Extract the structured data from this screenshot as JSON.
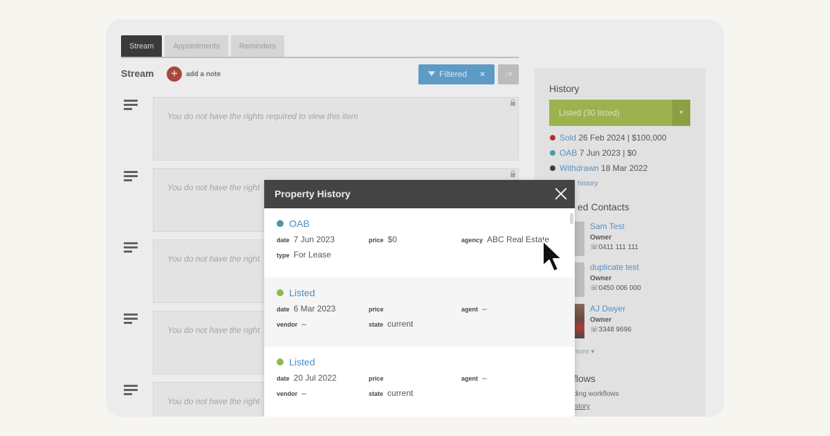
{
  "tabs": [
    "Stream",
    "Appointments",
    "Reminders"
  ],
  "stream": {
    "title": "Stream",
    "add_note": "add a note",
    "filter_label": "Filtered",
    "filter_clear": "×",
    "sort_label": "↓≡",
    "items": [
      "You do not have the rights required to view this item",
      "You do not have the right",
      "You do not have the right",
      "You do not have the right",
      "You do not have the right"
    ]
  },
  "side": {
    "history_title": "History",
    "listed_select": "Listed (30 listed)",
    "history": [
      {
        "status": "Sold",
        "detail": "26 Feb 2024 | $100,000",
        "color": "#b4302a"
      },
      {
        "status": "OAB",
        "detail": "7 Jun 2023 | $0",
        "color": "#4a9a9e"
      },
      {
        "status": "Withdrawn",
        "detail": "18 Mar 2022",
        "color": "#3b3b45"
      }
    ],
    "history_link": "history",
    "contacts_title": "ed Contacts",
    "contacts": [
      {
        "name": "Sam Test",
        "role": "Owner",
        "phone": "0411 111 111"
      },
      {
        "name": "duplicate test",
        "role": "Owner",
        "phone": "0450 006 000"
      },
      {
        "name": "AJ Dwyer",
        "role": "Owner",
        "phone": "3348 9696"
      }
    ],
    "more_link": "more ▾",
    "workflows_title": "flows",
    "workflows_text": "ding workflows",
    "workflows_link": "istory"
  },
  "modal": {
    "title": "Property History",
    "entries": [
      {
        "status": "OAB",
        "dot": "#4a9a9e",
        "fields": [
          {
            "label": "date",
            "value": "7 Jun 2023"
          },
          {
            "label": "price",
            "value": "$0"
          },
          {
            "label": "agency",
            "value": "ABC Real Estate"
          },
          {
            "label": "type",
            "value": "For Lease"
          }
        ]
      },
      {
        "status": "Listed",
        "dot": "#8fb84a",
        "fields": [
          {
            "label": "date",
            "value": "6 Mar 2023"
          },
          {
            "label": "price",
            "value": ""
          },
          {
            "label": "agent",
            "value": "–"
          },
          {
            "label": "vendor",
            "value": "–"
          },
          {
            "label": "state",
            "value": "current"
          }
        ]
      },
      {
        "status": "Listed",
        "dot": "#8fb84a",
        "fields": [
          {
            "label": "date",
            "value": "20 Jul 2022"
          },
          {
            "label": "price",
            "value": ""
          },
          {
            "label": "agent",
            "value": "–"
          },
          {
            "label": "vendor",
            "value": "–"
          },
          {
            "label": "state",
            "value": "current"
          }
        ]
      }
    ]
  },
  "colors": {
    "filter_blue": "#5e9ac6",
    "listed_green": "#9bb24f",
    "modal_header": "#444444",
    "link_blue": "#4d8cc3"
  }
}
